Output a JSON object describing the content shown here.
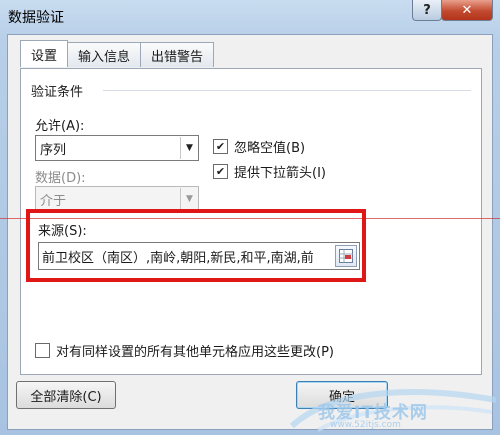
{
  "window": {
    "title": "数据验证",
    "help_label": "?",
    "close_label": "✕"
  },
  "tabs": [
    {
      "label": "设置",
      "active": true
    },
    {
      "label": "输入信息",
      "active": false
    },
    {
      "label": "出错警告",
      "active": false
    }
  ],
  "settings": {
    "group_title": "验证条件",
    "allow_label": "允许(A):",
    "allow_value": "序列",
    "data_label": "数据(D):",
    "data_value": "介于",
    "ignore_blank": {
      "label": "忽略空值(B)",
      "checked": true
    },
    "dropdown": {
      "label": "提供下拉箭头(I)",
      "checked": true
    },
    "source_label": "来源(S):",
    "source_value": "前卫校区（南区）,南岭,朝阳,新民,和平,南湖,前",
    "apply_all": {
      "label": "对有同样设置的所有其他单元格应用这些更改(P)",
      "checked": false
    }
  },
  "buttons": {
    "clear_all": "全部清除(C)",
    "ok": "确定"
  },
  "watermark": {
    "text": "我爱IT技术网",
    "url": "www.52itjs.com"
  },
  "colors": {
    "highlight": "#e01717",
    "accent": "#3c7fb1"
  }
}
